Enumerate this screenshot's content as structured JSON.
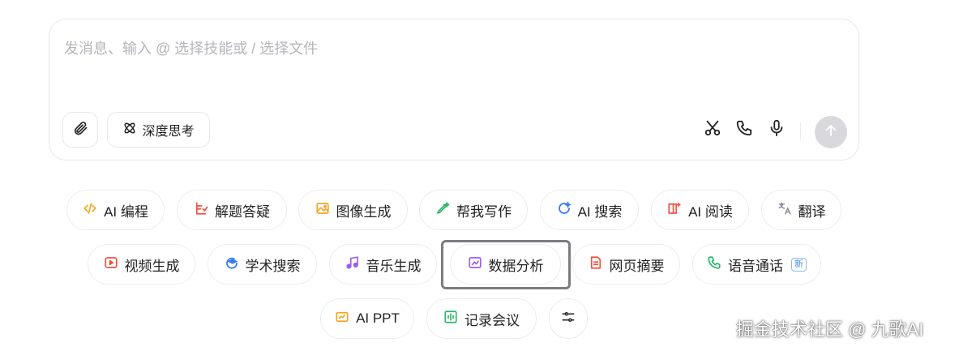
{
  "input": {
    "placeholder": "发消息、输入 @ 选择技能或 / 选择文件",
    "deep_think_label": "深度思考"
  },
  "icons": {
    "attach": "paperclip-icon",
    "deep_think": "atom-icon",
    "scissors": "scissors-icon",
    "phone": "phone-icon",
    "mic": "microphone-icon",
    "send": "arrow-up-icon",
    "settings": "sliders-icon"
  },
  "skills": {
    "row1": [
      {
        "label": "AI 编程",
        "icon": "code-icon",
        "color": "#f5a623"
      },
      {
        "label": "解题答疑",
        "icon": "question-icon",
        "color": "#f0503c"
      },
      {
        "label": "图像生成",
        "icon": "image-icon",
        "color": "#f5a623"
      },
      {
        "label": "帮我写作",
        "icon": "pen-icon",
        "color": "#2db56a"
      },
      {
        "label": "AI 搜索",
        "icon": "search-icon",
        "color": "#3a7bf5"
      },
      {
        "label": "AI 阅读",
        "icon": "book-icon",
        "color": "#f0503c"
      },
      {
        "label": "翻译",
        "icon": "translate-icon",
        "color": "#8a8f99"
      }
    ],
    "row2": [
      {
        "label": "视频生成",
        "icon": "video-icon",
        "color": "#f0503c"
      },
      {
        "label": "学术搜索",
        "icon": "academic-icon",
        "color": "#3a7bf5"
      },
      {
        "label": "音乐生成",
        "icon": "music-icon",
        "color": "#9b5cf0"
      },
      {
        "label": "数据分析",
        "icon": "chart-icon",
        "color": "#9b5cf0"
      },
      {
        "label": "网页摘要",
        "icon": "document-icon",
        "color": "#f0503c"
      },
      {
        "label": "语音通话",
        "icon": "phone-icon",
        "color": "#2db56a",
        "badge": "新"
      }
    ],
    "row3": [
      {
        "label": "AI PPT",
        "icon": "slides-icon",
        "color": "#f5a623"
      },
      {
        "label": "记录会议",
        "icon": "audio-wave-icon",
        "color": "#2db56a"
      }
    ]
  },
  "watermark": "掘金技术社区 @ 九歌AI"
}
